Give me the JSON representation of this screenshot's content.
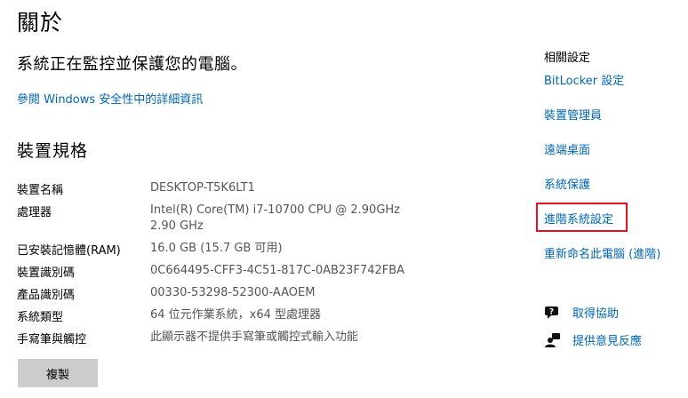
{
  "page": {
    "title": "關於",
    "protect_message": "系統正在監控並保護您的電腦。",
    "details_link": "參閱 Windows 安全性中的詳細資訊",
    "specs_title": "裝置規格"
  },
  "specs": [
    {
      "label": "裝置名稱",
      "value": "DESKTOP-T5K6LT1",
      "value2": ""
    },
    {
      "label": "處理器",
      "value": "Intel(R) Core(TM) i7-10700 CPU @ 2.90GHz",
      "value2": "2.90 GHz"
    },
    {
      "label": "已安裝記憶體(RAM)",
      "value": "16.0 GB (15.7 GB 可用)",
      "value2": ""
    },
    {
      "label": "裝置識別碼",
      "value": "0C664495-CFF3-4C51-817C-0AB23F742FBA",
      "value2": ""
    },
    {
      "label": "產品識別碼",
      "value": "00330-53298-52300-AAOEM",
      "value2": ""
    },
    {
      "label": "系統類型",
      "value": "64 位元作業系統，x64 型處理器",
      "value2": ""
    },
    {
      "label": "手寫筆與觸控",
      "value": "此顯示器不提供手寫筆或觸控式輸入功能",
      "value2": ""
    }
  ],
  "copy_button": "複製",
  "related": {
    "title": "相關設定",
    "links": [
      "BitLocker 設定",
      "裝置管理員",
      "遠端桌面",
      "系統保護",
      "進階系統設定",
      "重新命名此電腦 (進階)"
    ]
  },
  "help": {
    "get_help": "取得協助",
    "feedback": "提供意見反應"
  },
  "colors": {
    "link": "#0066b4",
    "highlight": "#e81123"
  }
}
